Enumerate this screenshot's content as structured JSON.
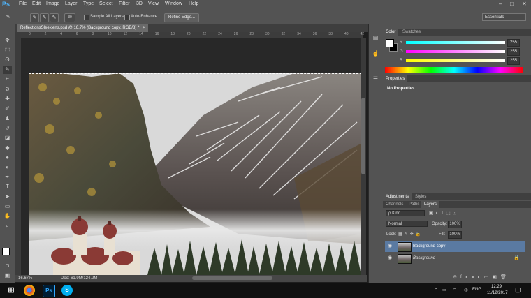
{
  "app": {
    "logo": "Ps"
  },
  "menu": [
    "File",
    "Edit",
    "Image",
    "Layer",
    "Type",
    "Select",
    "Filter",
    "3D",
    "View",
    "Window",
    "Help"
  ],
  "window_controls": {
    "minimize": "–",
    "maximize": "□",
    "close": "✕"
  },
  "options": {
    "brush_size": "30",
    "sample_all_layers": "Sample All Layers",
    "auto_enhance": "Auto-Enhance",
    "refine_edge": "Refine Edge...",
    "workspace": "Essentials"
  },
  "document": {
    "tab_title": "ReflectionsSleeklens.psd @ 16.7% (Background copy, RGB/8) *",
    "close": "×",
    "zoom": "16.67%",
    "doc_size": "Doc: 61.9M/124.2M"
  },
  "ruler_ticks": [
    "0",
    "2",
    "4",
    "6",
    "8",
    "10",
    "12",
    "14",
    "16",
    "18",
    "20",
    "22",
    "24",
    "26",
    "28",
    "30",
    "32",
    "34",
    "36",
    "38",
    "40",
    "42"
  ],
  "color_panel": {
    "tabs": [
      "Color",
      "Swatches"
    ],
    "channels": [
      {
        "label": "R",
        "value": "255",
        "gradient": "linear-gradient(to right,#0ff,#fff)"
      },
      {
        "label": "G",
        "value": "255",
        "gradient": "linear-gradient(to right,#f0f,#fff)"
      },
      {
        "label": "B",
        "value": "255",
        "gradient": "linear-gradient(to right,#ff0,#fff)"
      }
    ]
  },
  "properties_panel": {
    "tab": "Properties",
    "text": "No Properties"
  },
  "adjustments_tabs": [
    "Adjustments",
    "Styles"
  ],
  "layers_panel": {
    "tabs": [
      "Channels",
      "Paths",
      "Layers"
    ],
    "kind": "ρ Kind",
    "blend_mode": "Normal",
    "opacity_label": "Opacity:",
    "opacity": "100%",
    "lock_label": "Lock:",
    "fill_label": "Fill:",
    "fill": "100%",
    "layers": [
      {
        "name": "Background copy",
        "selected": true
      },
      {
        "name": "Background",
        "selected": false
      }
    ]
  },
  "taskbar": {
    "language": "ENG",
    "time": "12:29",
    "date": "11/12/2017"
  },
  "colors": {
    "ps_blue": "#4fb7ff",
    "selected_layer": "#5a7aa2",
    "panel": "#535353"
  }
}
